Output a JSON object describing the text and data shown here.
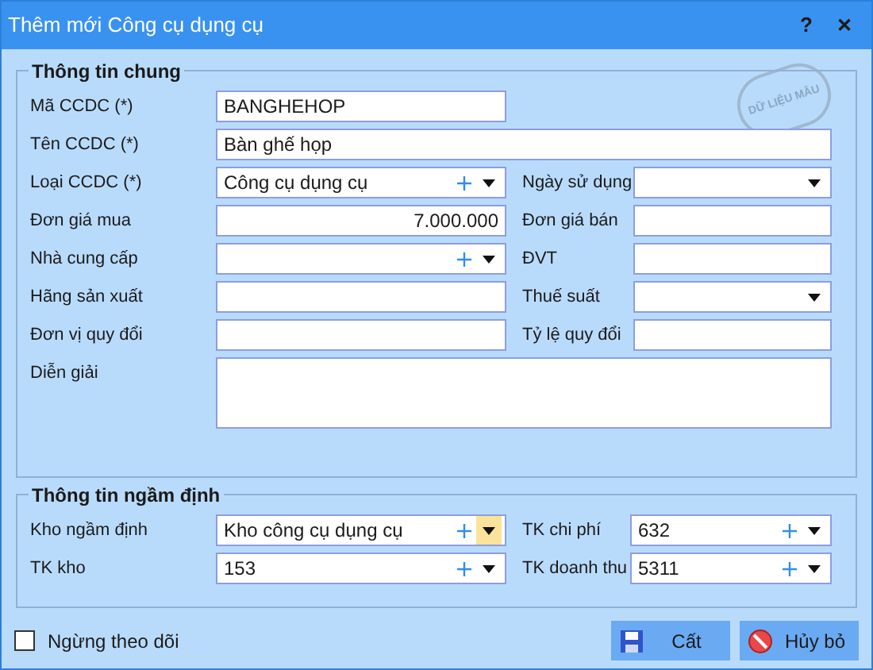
{
  "window": {
    "title": "Thêm mới Công cụ dụng cụ",
    "help": "?",
    "close": "✕"
  },
  "stamp": "DỮ LIỆU MẪU",
  "general": {
    "title": "Thông tin chung",
    "rows": [
      [
        {
          "label": "Mã CCDC (*)",
          "value": "BANGHEHOP",
          "kind": "text",
          "wide": false
        }
      ],
      [
        {
          "label": "Tên CCDC (*)",
          "value": "Bàn ghế họp",
          "kind": "text",
          "wide": true
        }
      ],
      [
        {
          "label": "Loại CCDC (*)",
          "value": "Công cụ dụng cụ",
          "kind": "lookup",
          "caret_highlighted": false
        },
        {
          "label": "Ngày sử dụng",
          "kind": "dropdown"
        }
      ],
      [
        {
          "label": "Đơn giá mua",
          "value": "7.000.000",
          "kind": "number"
        },
        {
          "label": "Đơn giá bán",
          "kind": "text",
          "wide": false
        }
      ],
      [
        {
          "label": "Nhà cung cấp",
          "kind": "lookup",
          "caret_highlighted": false
        },
        {
          "label": "ĐVT",
          "kind": "text",
          "wide": false
        }
      ],
      [
        {
          "label": "Hãng sản xuất",
          "kind": "text",
          "wide": false
        },
        {
          "label": "Thuế suất",
          "kind": "dropdown"
        }
      ],
      [
        {
          "label": "Đơn vị quy đổi",
          "kind": "text",
          "wide": false
        },
        {
          "label": "Tỷ lệ quy đổi",
          "kind": "text",
          "wide": false
        }
      ],
      [
        {
          "label": "Diễn giải",
          "kind": "textarea"
        }
      ]
    ]
  },
  "defaults": {
    "title": "Thông tin ngầm định",
    "rows": [
      [
        {
          "label": "Kho ngầm định",
          "value": "Kho công cụ dụng cụ",
          "kind": "lookup",
          "caret_highlighted": true
        },
        {
          "label": "TK chi phí",
          "value": "632",
          "kind": "lookup",
          "caret_highlighted": false
        }
      ],
      [
        {
          "label": "TK kho",
          "value": "153",
          "kind": "lookup",
          "caret_highlighted": false
        },
        {
          "label": "TK doanh thu",
          "value": "5311",
          "kind": "lookup",
          "caret_highlighted": false
        }
      ]
    ]
  },
  "stop_tracking": {
    "label": "Ngừng theo dõi",
    "checked": false
  },
  "buttons": [
    {
      "label": "Cất",
      "kind": "save"
    },
    {
      "label": "Hủy bỏ",
      "kind": "cancel"
    }
  ]
}
